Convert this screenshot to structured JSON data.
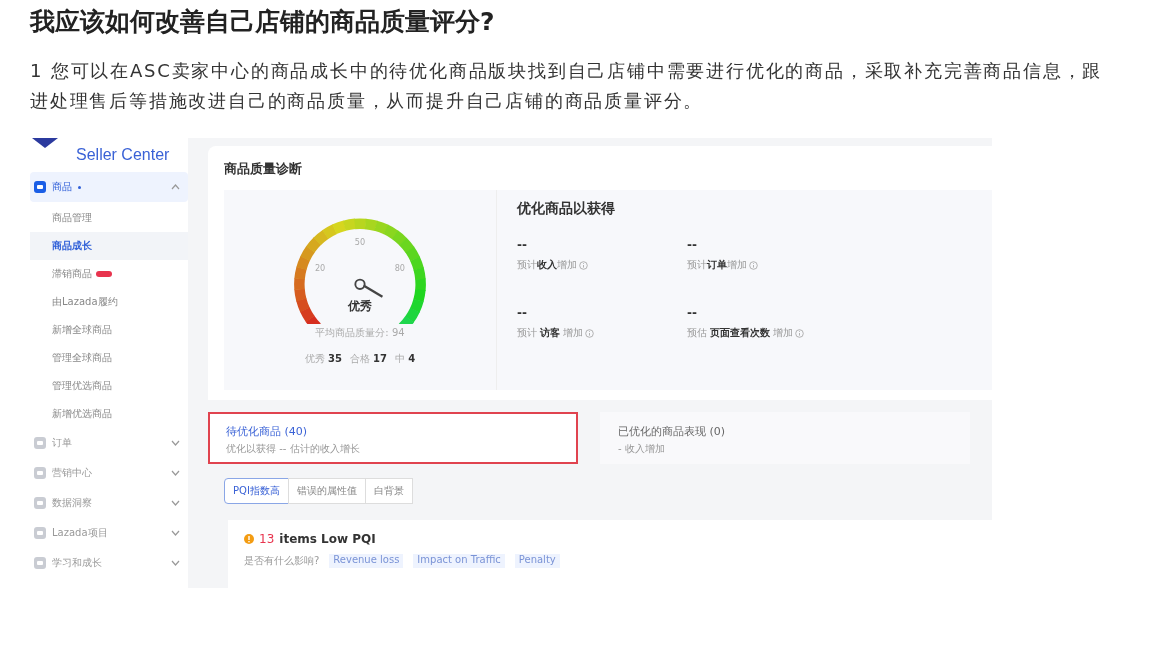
{
  "article": {
    "title": "我应该如何改善自己店铺的商品质量评分?",
    "paragraph": "1 您可以在ASC卖家中心的商品成长中的待优化商品版块找到自己店铺中需要进行优化的商品，采取补充完善商品信息，跟进处理售后等措施改进自己的商品质量，从而提升自己店铺的商品质量评分。"
  },
  "screenshot": {
    "brand": "Seller Center",
    "sidebar": [
      {
        "label": "商品",
        "dot": true,
        "expanded": true,
        "children": [
          {
            "label": "商品管理",
            "selected": false,
            "badge": false
          },
          {
            "label": "商品成长",
            "selected": true,
            "badge": false
          },
          {
            "label": "滞销商品",
            "selected": false,
            "badge": true
          },
          {
            "label": "由Lazada履约",
            "selected": false,
            "badge": false
          },
          {
            "label": "新增全球商品",
            "selected": false,
            "badge": false
          },
          {
            "label": "管理全球商品",
            "selected": false,
            "badge": false
          },
          {
            "label": "管理优选商品",
            "selected": false,
            "badge": false
          },
          {
            "label": "新增优选商品",
            "selected": false,
            "badge": false
          }
        ]
      },
      {
        "label": "订单",
        "dot": false,
        "expanded": false
      },
      {
        "label": "营销中心",
        "dot": false,
        "expanded": false
      },
      {
        "label": "数据洞察",
        "dot": false,
        "expanded": false
      },
      {
        "label": "Lazada项目",
        "dot": false,
        "expanded": false
      },
      {
        "label": "学习和成长",
        "dot": false,
        "expanded": false
      }
    ],
    "card_title": "商品质量诊断",
    "gauge": {
      "ticks": [
        "20",
        "50",
        "80"
      ],
      "rating": "优秀",
      "caption": "平均商品质量分: 94",
      "counts": [
        {
          "label": "优秀",
          "value": "35"
        },
        {
          "label": "合格",
          "value": "17"
        },
        {
          "label": "中",
          "value": "4"
        }
      ]
    },
    "gains": {
      "title": "优化商品以获得",
      "metrics": [
        {
          "value": "--",
          "label": "预计**收入**增加"
        },
        {
          "value": "--",
          "label": "预计**订单**增加"
        },
        {
          "value": "--",
          "label": "预计 **访客** 增加"
        },
        {
          "value": "--",
          "label": "预估 **页面查看次数** 增加"
        }
      ]
    },
    "tabs": [
      {
        "title": "待优化商品 (40)",
        "subtitle": "优化以获得 -- 估计的收入增长",
        "selected": true,
        "highlighted": true
      },
      {
        "title": "已优化的商品表现 (0)",
        "subtitle": "- 收入增加",
        "selected": false,
        "highlighted": false
      }
    ],
    "filters": [
      {
        "label": "PQI指数高",
        "selected": true
      },
      {
        "label": "错误的属性值",
        "selected": false
      },
      {
        "label": "白背景",
        "selected": false
      }
    ],
    "issue": {
      "count": "13",
      "text": "items Low PQI",
      "question": "是否有什么影响?",
      "tags": [
        "Revenue loss",
        "Impact on Traffic",
        "Penalty"
      ]
    }
  }
}
